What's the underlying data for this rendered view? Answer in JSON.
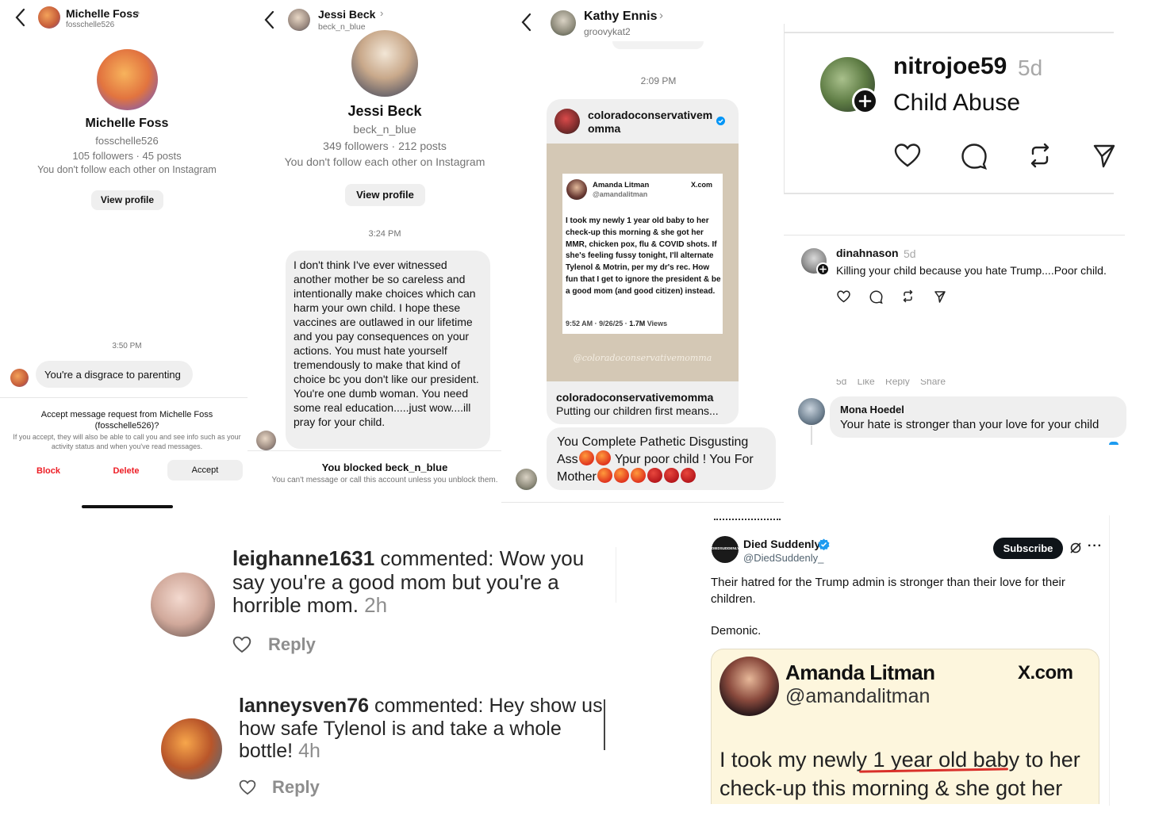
{
  "p1": {
    "header_name": "Michelle Foss",
    "header_username": "fosschelle526",
    "profile_name": "Michelle Foss",
    "profile_username": "fosschelle526",
    "stats": "105 followers · 45 posts",
    "follow_note": "You don't follow each other on Instagram",
    "view_profile": "View profile",
    "time": "3:50 PM",
    "message": "You're a disgrace to parenting",
    "request_title": "Accept message request from Michelle Foss (fosschelle526)?",
    "request_info": "If you accept, they will also be able to call you and see info such as your activity status and when you've read messages.",
    "block": "Block",
    "delete": "Delete",
    "accept": "Accept"
  },
  "p2": {
    "header_name": "Jessi Beck",
    "header_username": "beck_n_blue",
    "profile_name": "Jessi Beck",
    "profile_username": "beck_n_blue",
    "stats": "349 followers · 212 posts",
    "follow_note": "You don't follow each other on Instagram",
    "view_profile": "View profile",
    "time": "3:24 PM",
    "message": "I don't think I've ever witnessed another mother be so careless and intentionally make choices which can harm your own child. I hope these vaccines are outlawed in our lifetime and you pay consequences on your actions. You must hate yourself tremendously to make that kind of choice bc you don't like our president. You're one dumb woman. You need some real education.....just wow....ill pray for your child.",
    "blocked_title": "You blocked beck_n_blue",
    "blocked_info": "You can't message or call this account unless you unblock them."
  },
  "p3": {
    "header_name": "Kathy Ennis",
    "header_username": "groovykat2",
    "time": "2:09 PM",
    "share_account": "coloradoconservativemomma",
    "inner_name": "Amanda Litman",
    "inner_handle": "@amandalitman",
    "inner_logo": "X.com",
    "inner_text": "I took my newly 1 year old baby to her check-up this morning & she got her MMR, chicken pox, flu & COVID shots. If she's feeling fussy tonight, I'll alternate Tylenol & Motrin, per my dr's rec. How fun that I get to ignore the president & be a good mom (and good citizen) instead.",
    "inner_meta": "9:52 AM · 9/26/25 · ",
    "inner_views": "1.7M",
    "inner_views_label": " Views",
    "watermark": "@coloradoconservativemomma",
    "footer_account": "coloradoconservativemomma",
    "footer_caption": "Putting our children first means...",
    "reply_text": "You Complete  Pathetic  Disgusting Ass",
    "reply_text2": " Ypur poor child !  You For Mother"
  },
  "p4": {
    "username": "nitrojoe59",
    "age": "5d",
    "post_text": "Child Abuse",
    "reply_user": "dinahnason",
    "reply_age": "5d",
    "reply_text": "Killing your child because you hate Trump....Poor child.",
    "partial_row": "5d    Like    Reply    Share",
    "mona_name": "Mona Hoedel",
    "mona_text": "Your hate is stronger than your love for your child"
  },
  "p5": {
    "c1_user": "leighanne1631",
    "c1_text": " commented: Wow you say you're a good mom but you're a horrible mom.",
    "c1_time": "2h",
    "c2_user": "lanneysven76",
    "c2_text": " commented: Hey show us how safe Tylenol is and take a whole bottle!",
    "c2_time": "4h",
    "reply": "Reply"
  },
  "p6": {
    "avatar_text": "DIEDSUDDENLY.COM",
    "name": "Died Suddenly",
    "handle": "@DiedSuddenly_",
    "subscribe": "Subscribe",
    "text1": "Their hatred for the Trump admin is stronger than their love for their children.",
    "text2": "Demonic.",
    "embed_name": "Amanda Litman",
    "embed_handle": "@amandalitman",
    "embed_logo": "X.com",
    "embed_text": "I took my newly 1 year old baby to her check-up this morning & she got her"
  },
  "colors": {
    "ig_red": "#ed1c24",
    "bubble_gray": "#efefef",
    "muted": "#737373",
    "verified_blue": "#1d9bf0",
    "screenshot_beige": "#d4c8b5",
    "embed_cream": "#fdf6dd"
  },
  "icons": [
    "back-chevron-icon",
    "heart-icon",
    "comment-icon",
    "repost-icon",
    "share-icon",
    "follow-plus-icon",
    "verified-badge-icon",
    "grok-icon",
    "more-icon"
  ]
}
